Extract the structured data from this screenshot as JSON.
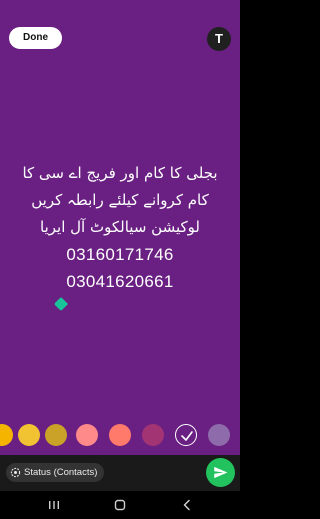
{
  "topbar": {
    "done_label": "Done",
    "text_tool_label": "T"
  },
  "status_text": {
    "line1": "بجلی کا کام اور فریج اے سی کا",
    "line2": "کام کروانے کیلئے رابطہ کریں",
    "line3": "لوکیشن سیالکوٹ آل ایریا",
    "phone1": "03160171746",
    "phone2": "03041620661"
  },
  "palette": {
    "colors": [
      "#f4b400",
      "#f1c232",
      "#c9a227",
      "#ff8a8a",
      "#ff7a6b",
      "#a23474",
      "selected",
      "#8e6cab"
    ]
  },
  "bottombar": {
    "status_label": "Status (Contacts)"
  },
  "colors": {
    "background": "#6a2082",
    "send_button": "#22c35e",
    "cursor_handle": "#19c39a"
  },
  "icons": {
    "text_tool": "text-tool-icon",
    "send": "send-icon",
    "privacy": "status-privacy-icon",
    "nav_recents": "recents-icon",
    "nav_home": "home-icon",
    "nav_back": "back-icon"
  }
}
